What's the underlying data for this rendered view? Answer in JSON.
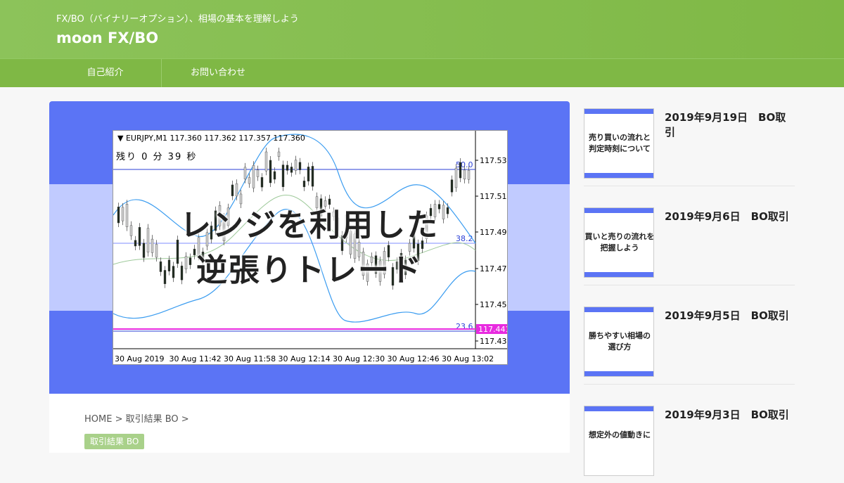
{
  "header": {
    "tagline": "FX/BO（バイナリーオプション）、相場の基本を理解しよう",
    "site_title": "moon FX/BO",
    "brand_color": "#8cc35a"
  },
  "nav": {
    "items": [
      {
        "label": "自己紹介"
      },
      {
        "label": "お問い合わせ"
      }
    ]
  },
  "article": {
    "eyecatch": {
      "title_line1": "レンジを利用した",
      "title_line2": "逆張りトレード",
      "chart_header": "▼ EURJPY,M1  117.360 117.362 117.357 117.360",
      "chart_timer": "残り 0 分 39 秒",
      "price_ticks": [
        "117.535",
        "117.515",
        "117.495",
        "117.475",
        "117.455",
        "117.435"
      ],
      "fib_labels": [
        "50.0",
        "38.2",
        "23.6"
      ],
      "current_price": "117.441",
      "time_ticks": [
        "30 Aug 2019",
        "30 Aug 11:42",
        "30 Aug 11:58",
        "30 Aug 12:14",
        "30 Aug 12:30",
        "30 Aug 12:46",
        "30 Aug 13:02"
      ],
      "bg_color": "#5b74f5"
    },
    "breadcrumb": "HOME > 取引結果 BO >",
    "category": "取引結果 BO"
  },
  "sidebar": {
    "posts": [
      {
        "title": "2019年9月19日　BO取引",
        "thumb_line1": "売り買いの流れと",
        "thumb_line2": "判定時刻について"
      },
      {
        "title": "2019年9月6日　BO取引",
        "thumb_line1": "買いと売りの流れを",
        "thumb_line2": "把握しよう"
      },
      {
        "title": "2019年9月5日　BO取引",
        "thumb_line1": "勝ちやすい相場の",
        "thumb_line2": "選び方"
      },
      {
        "title": "2019年9月3日　BO取引",
        "thumb_line1": "想定外の値動きに",
        "thumb_line2": ""
      }
    ]
  }
}
